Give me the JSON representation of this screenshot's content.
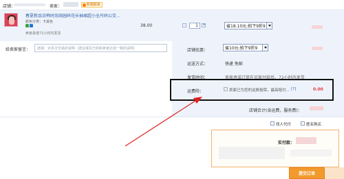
{
  "header": {
    "shop_label": "店铺：",
    "seller_label": "卖家：",
    "contact_label": "和我联系"
  },
  "product": {
    "title": "春夏新品日韩时尚田园碎花长袖裙超小全尺码公交...",
    "color": "颜色分类：卡其色",
    "promise": "卖家承诺72小时内发货",
    "price": "38.00",
    "quantity": "1",
    "discount": "省18.10元:拍下9折9"
  },
  "message": {
    "label": "给卖家留言：",
    "placeholder": "选填：对本次交易的说明（建议填写已经和卖家达成一致的说明）"
  },
  "options": {
    "shop_discount_label": "店铺优惠：",
    "shop_discount": "省10元:拍下9折9",
    "shipping_label": "运送方式：",
    "shipping_value": "快递 免邮",
    "ship_time_label": "发货时间：",
    "ship_time_value": "卖家承诺订单在买家付款后，72小时内发货",
    "freight_label": "运费险：",
    "freight_text": "卖家已为您的运费投保，最高赔付...",
    "freight_help": "[?]",
    "freight_price": "0.00",
    "total_label": "店铺合计(含运费，服务费)："
  },
  "footer": {
    "proxy_label": "找人代付",
    "anon_label": "匿名购买",
    "paid_label": "实付款：",
    "submit_label": "提交订单"
  },
  "colors": {
    "accent_red": "#e4393c",
    "button_orange": "#f39a2d",
    "row_bg": "#eef3fb",
    "annotation_arrow": "#e02020"
  }
}
